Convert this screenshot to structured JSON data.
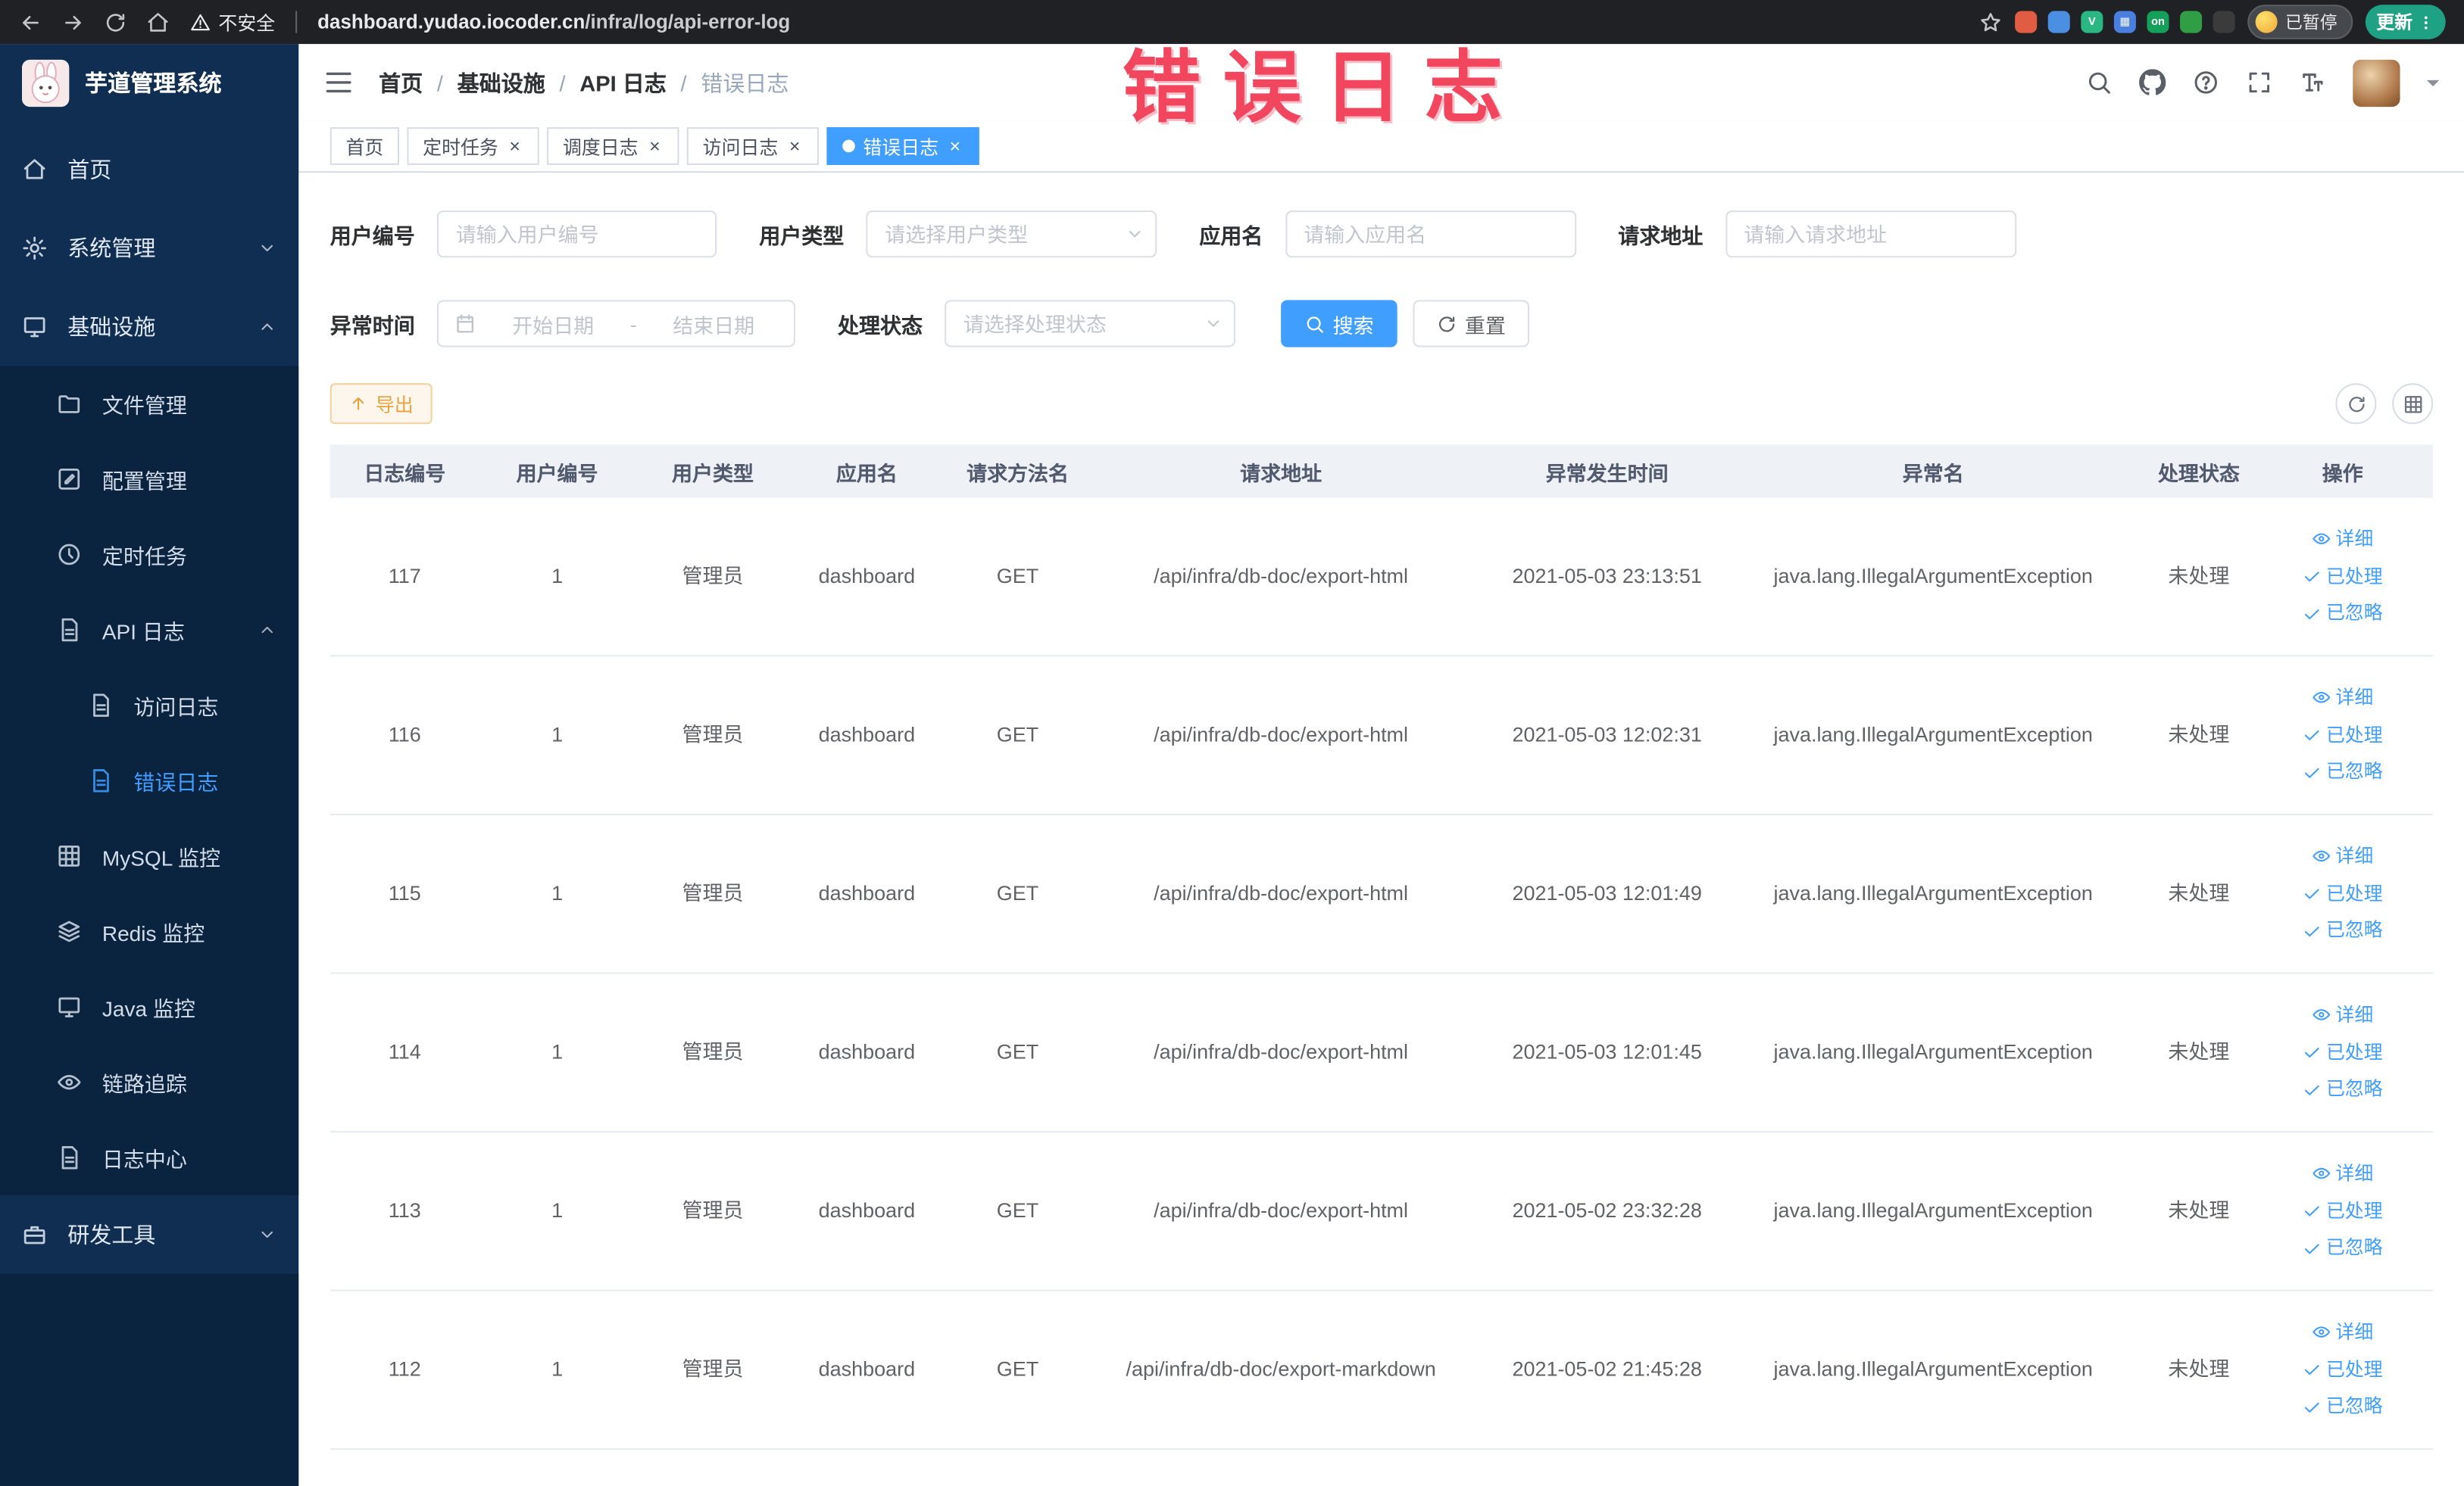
{
  "colors": {
    "accent": "#409eff",
    "sidebar_bg": "#0f2e52",
    "sidebar_submenu_bg": "#0a2440",
    "chrome_bg": "#202124",
    "warning_button": "#e6a23c",
    "table_header_bg": "#eef1f6",
    "annotation_red": "#f2465f"
  },
  "browser": {
    "nav_icons": [
      "back-icon",
      "forward-icon",
      "reload-icon",
      "browser-home-icon"
    ],
    "security_label": "不安全",
    "url_host": "dashboard.yudao.iocoder.cn",
    "url_path": "/infra/log/api-error-log",
    "star_icon": "star-icon",
    "extensions": [
      {
        "name": "extension-red-icon",
        "bg": "#e05d44",
        "glyph": ""
      },
      {
        "name": "extension-blue-icon",
        "bg": "#4a8fe2",
        "glyph": ""
      },
      {
        "name": "vue-devtools-icon",
        "bg": "#2ab784",
        "glyph": "V"
      },
      {
        "name": "extension-grid-icon",
        "bg": "#4a7fe0",
        "glyph": "▦"
      },
      {
        "name": "proxy-on-icon",
        "bg": "#15a05a",
        "glyph": "on"
      },
      {
        "name": "leaf-extension-icon",
        "bg": "#2f9e44",
        "glyph": ""
      },
      {
        "name": "paw-extension-icon",
        "bg": "#3b3b3b",
        "glyph": ""
      }
    ],
    "paused_badge": "已暂停",
    "update_button": "更新"
  },
  "annotation": {
    "text": "错误日志"
  },
  "sidebar": {
    "title": "芋道管理系统",
    "items": [
      {
        "name": "home",
        "label": "首页",
        "icon": "home-icon",
        "level": 1
      },
      {
        "name": "system-mgmt",
        "label": "系统管理",
        "icon": "gear-icon",
        "level": 1,
        "expand": "down"
      },
      {
        "name": "infra",
        "label": "基础设施",
        "icon": "monitor-icon",
        "level": 1,
        "expand": "up"
      },
      {
        "name": "file-mgmt",
        "label": "文件管理",
        "icon": "folder-icon",
        "level": 2
      },
      {
        "name": "config-mgmt",
        "label": "配置管理",
        "icon": "edit-icon",
        "level": 2
      },
      {
        "name": "job",
        "label": "定时任务",
        "icon": "clock-icon",
        "level": 2
      },
      {
        "name": "api-log",
        "label": "API 日志",
        "icon": "doc-icon",
        "level": 2,
        "expand": "up"
      },
      {
        "name": "access-log",
        "label": "访问日志",
        "icon": "doc-icon",
        "level": 3
      },
      {
        "name": "error-log",
        "label": "错误日志",
        "icon": "doc-icon",
        "level": 3,
        "active": true
      },
      {
        "name": "mysql-monitor",
        "label": "MySQL 监控",
        "icon": "grid-icon",
        "level": 2
      },
      {
        "name": "redis-monitor",
        "label": "Redis 监控",
        "icon": "layers-icon",
        "level": 2
      },
      {
        "name": "java-monitor",
        "label": "Java 监控",
        "icon": "monitor-icon",
        "level": 2
      },
      {
        "name": "tracer",
        "label": "链路追踪",
        "icon": "eye-icon",
        "level": 2
      },
      {
        "name": "log-center",
        "label": "日志中心",
        "icon": "doc-icon",
        "level": 2
      },
      {
        "name": "dev-tools",
        "label": "研发工具",
        "icon": "toolbox-icon",
        "level": 1,
        "expand": "down"
      }
    ]
  },
  "header": {
    "breadcrumb": [
      "首页",
      "基础设施",
      "API 日志",
      "错误日志"
    ],
    "breadcrumb_separator": "/",
    "icons": [
      "search-icon",
      "github-icon",
      "help-icon",
      "fullscreen-icon",
      "font-size-icon"
    ]
  },
  "tabs_close_glyph": "×",
  "tabs": [
    {
      "name": "home",
      "label": "首页",
      "closable": false,
      "active": false
    },
    {
      "name": "job",
      "label": "定时任务",
      "closable": true,
      "active": false
    },
    {
      "name": "job-log",
      "label": "调度日志",
      "closable": true,
      "active": false
    },
    {
      "name": "access-log",
      "label": "访问日志",
      "closable": true,
      "active": false
    },
    {
      "name": "error-log",
      "label": "错误日志",
      "closable": true,
      "active": true
    }
  ],
  "filters": {
    "user_id": {
      "label": "用户编号",
      "placeholder": "请输入用户编号"
    },
    "user_type": {
      "label": "用户类型",
      "placeholder": "请选择用户类型"
    },
    "app_name": {
      "label": "应用名",
      "placeholder": "请输入应用名"
    },
    "request_url": {
      "label": "请求地址",
      "placeholder": "请输入请求地址"
    },
    "exception_time": {
      "label": "异常时间",
      "start_placeholder": "开始日期",
      "separator": "-",
      "end_placeholder": "结束日期"
    },
    "process_status": {
      "label": "处理状态",
      "placeholder": "请选择处理状态"
    },
    "search_button": "搜索",
    "reset_button": "重置"
  },
  "toolbar": {
    "export_button": "导出"
  },
  "table": {
    "columns": [
      "日志编号",
      "用户编号",
      "用户类型",
      "应用名",
      "请求方法名",
      "请求地址",
      "异常发生时间",
      "异常名",
      "处理状态",
      "操作"
    ],
    "actions": [
      "详细",
      "已处理",
      "已忽略"
    ],
    "rows": [
      {
        "id": "117",
        "user_id": "1",
        "user_type": "管理员",
        "app": "dashboard",
        "method": "GET",
        "url": "/api/infra/db-doc/export-html",
        "time": "2021-05-03 23:13:51",
        "exception": "java.lang.IllegalArgumentException",
        "status": "未处理"
      },
      {
        "id": "116",
        "user_id": "1",
        "user_type": "管理员",
        "app": "dashboard",
        "method": "GET",
        "url": "/api/infra/db-doc/export-html",
        "time": "2021-05-03 12:02:31",
        "exception": "java.lang.IllegalArgumentException",
        "status": "未处理"
      },
      {
        "id": "115",
        "user_id": "1",
        "user_type": "管理员",
        "app": "dashboard",
        "method": "GET",
        "url": "/api/infra/db-doc/export-html",
        "time": "2021-05-03 12:01:49",
        "exception": "java.lang.IllegalArgumentException",
        "status": "未处理"
      },
      {
        "id": "114",
        "user_id": "1",
        "user_type": "管理员",
        "app": "dashboard",
        "method": "GET",
        "url": "/api/infra/db-doc/export-html",
        "time": "2021-05-03 12:01:45",
        "exception": "java.lang.IllegalArgumentException",
        "status": "未处理"
      },
      {
        "id": "113",
        "user_id": "1",
        "user_type": "管理员",
        "app": "dashboard",
        "method": "GET",
        "url": "/api/infra/db-doc/export-html",
        "time": "2021-05-02 23:32:28",
        "exception": "java.lang.IllegalArgumentException",
        "status": "未处理"
      },
      {
        "id": "112",
        "user_id": "1",
        "user_type": "管理员",
        "app": "dashboard",
        "method": "GET",
        "url": "/api/infra/db-doc/export-markdown",
        "time": "2021-05-02 21:45:28",
        "exception": "java.lang.IllegalArgumentException",
        "status": "未处理"
      }
    ]
  }
}
